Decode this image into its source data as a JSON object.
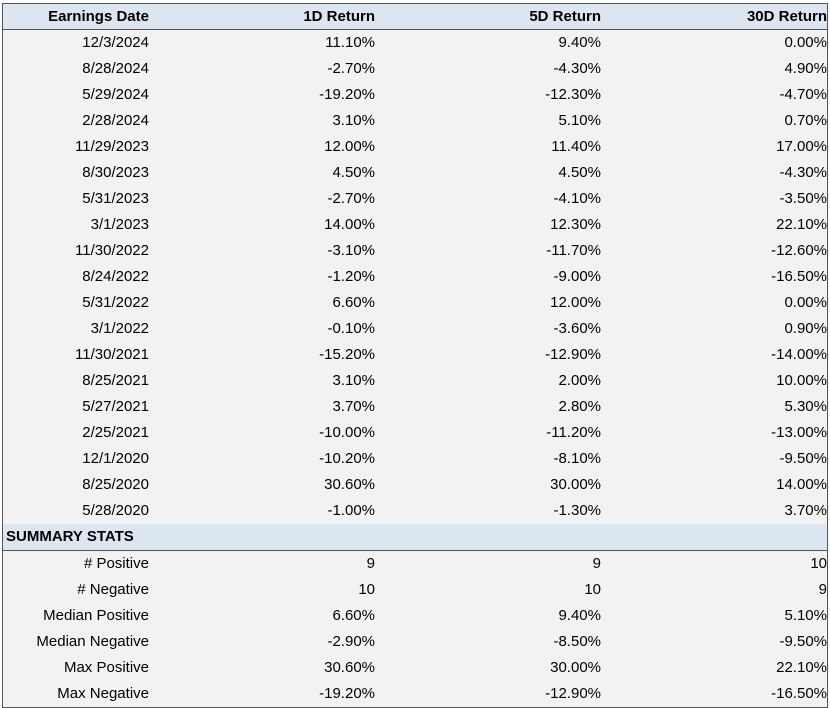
{
  "table": {
    "headers": [
      "Earnings Date",
      "1D Return",
      "5D Return",
      "30D Return"
    ],
    "rows": [
      [
        "12/3/2024",
        "11.10%",
        "9.40%",
        "0.00%"
      ],
      [
        "8/28/2024",
        "-2.70%",
        "-4.30%",
        "4.90%"
      ],
      [
        "5/29/2024",
        "-19.20%",
        "-12.30%",
        "-4.70%"
      ],
      [
        "2/28/2024",
        "3.10%",
        "5.10%",
        "0.70%"
      ],
      [
        "11/29/2023",
        "12.00%",
        "11.40%",
        "17.00%"
      ],
      [
        "8/30/2023",
        "4.50%",
        "4.50%",
        "-4.30%"
      ],
      [
        "5/31/2023",
        "-2.70%",
        "-4.10%",
        "-3.50%"
      ],
      [
        "3/1/2023",
        "14.00%",
        "12.30%",
        "22.10%"
      ],
      [
        "11/30/2022",
        "-3.10%",
        "-11.70%",
        "-12.60%"
      ],
      [
        "8/24/2022",
        "-1.20%",
        "-9.00%",
        "-16.50%"
      ],
      [
        "5/31/2022",
        "6.60%",
        "12.00%",
        "0.00%"
      ],
      [
        "3/1/2022",
        "-0.10%",
        "-3.60%",
        "0.90%"
      ],
      [
        "11/30/2021",
        "-15.20%",
        "-12.90%",
        "-14.00%"
      ],
      [
        "8/25/2021",
        "3.10%",
        "2.00%",
        "10.00%"
      ],
      [
        "5/27/2021",
        "3.70%",
        "2.80%",
        "5.30%"
      ],
      [
        "2/25/2021",
        "-10.00%",
        "-11.20%",
        "-13.00%"
      ],
      [
        "12/1/2020",
        "-10.20%",
        "-8.10%",
        "-9.50%"
      ],
      [
        "8/25/2020",
        "30.60%",
        "30.00%",
        "14.00%"
      ],
      [
        "5/28/2020",
        "-1.00%",
        "-1.30%",
        "3.70%"
      ]
    ]
  },
  "summary": {
    "title": "SUMMARY STATS",
    "rows": [
      [
        "# Positive",
        "9",
        "9",
        "10"
      ],
      [
        "# Negative",
        "10",
        "10",
        "9"
      ],
      [
        "Median Positive",
        "6.60%",
        "9.40%",
        "5.10%"
      ],
      [
        "Median Negative",
        "-2.90%",
        "-8.50%",
        "-9.50%"
      ],
      [
        "Max Positive",
        "30.60%",
        "30.00%",
        "22.10%"
      ],
      [
        "Max Negative",
        "-19.20%",
        "-12.90%",
        "-16.50%"
      ]
    ]
  }
}
